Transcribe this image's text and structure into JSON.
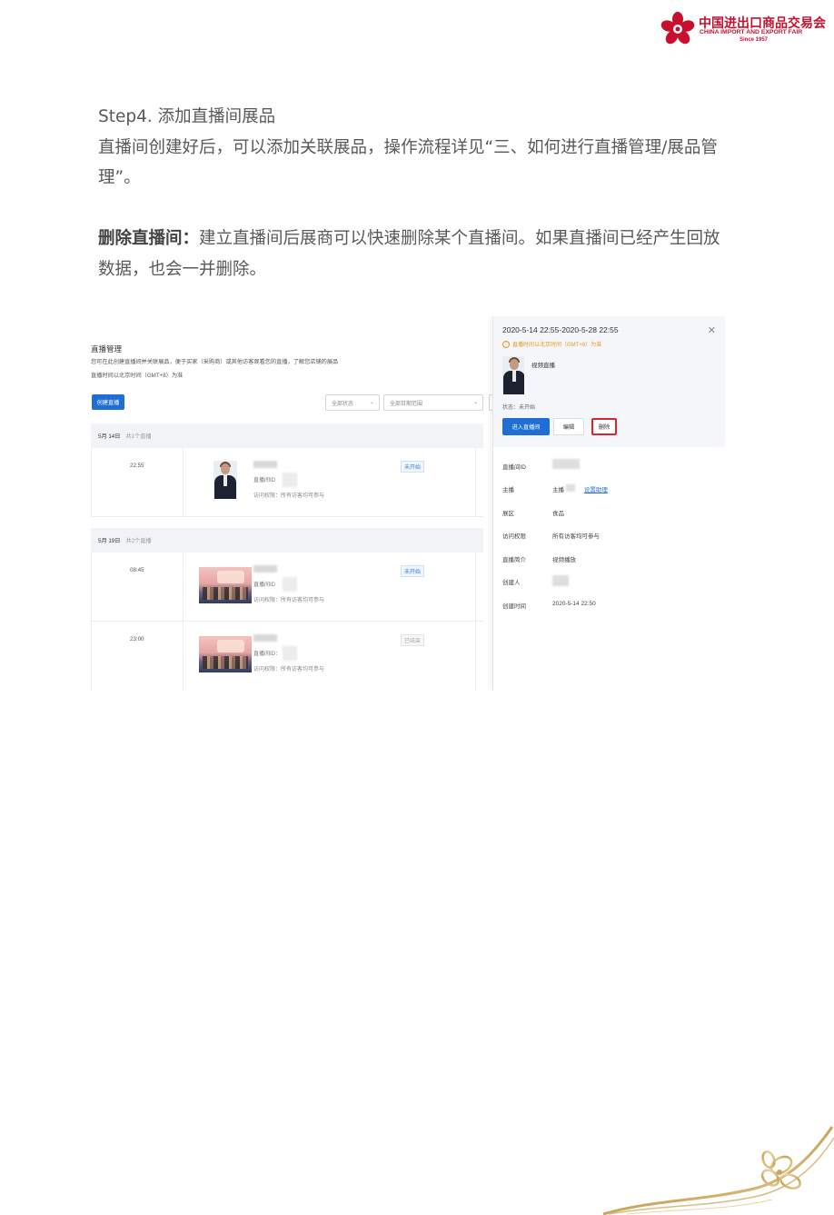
{
  "logo": {
    "cn": "中国进出口商品交易会",
    "en": "CHINA IMPORT AND EXPORT FAIR",
    "since": "Since 1957",
    "brand_color": "#c8102e"
  },
  "step4": {
    "heading": "Step4. 添加直播间展品",
    "body": "直播间创建好后，可以添加关联展品，操作流程详见“三、如何进行直播管理/展品管理”。"
  },
  "delete_section": {
    "label": "删除直播间：",
    "body": "建立直播间后展商可以快速删除某个直播间。如果直播间已经产生回放数据，也会一并删除。"
  },
  "screenshot": {
    "title": "直播管理",
    "desc": "您可在此创建直播间并关联展品，便于买家（采购商）或其他访客观看您的直播，了解您店铺的展品",
    "time_note": "直播时间以北京时间（GMT+8）为准",
    "create_button": "创建直播",
    "filter_status": "全部状态",
    "filter_date": "全部日期范围",
    "days": [
      {
        "date": "5月 14日",
        "count": "共1个直播",
        "rows": [
          {
            "time": "22:55",
            "id_label": "直播间ID",
            "permission": "访问权限：所有访客均可参与",
            "status": "未开始",
            "thumb": "person"
          }
        ]
      },
      {
        "date": "5月 19日",
        "count": "共2个直播",
        "rows": [
          {
            "time": "08:45",
            "id_label": "直播间ID",
            "permission": "访问权限：所有访客均可参与",
            "status": "未开始",
            "thumb": "banner"
          },
          {
            "time": "23:00",
            "id_label": "直播间ID：",
            "permission": "访问权限：所有访客均可参与",
            "status": "已结束",
            "thumb": "banner"
          }
        ]
      }
    ],
    "panel": {
      "range": "2020-5-14 22:55-2020-5-28 22:55",
      "warning": "直播时间以北京时间（GMT+8）为准",
      "name": "视频直播",
      "status": "状态：未开始",
      "enter_button": "进入直播间",
      "edit_button": "编辑",
      "delete_button": "删除",
      "info": [
        {
          "label": "直播间ID",
          "value": ""
        },
        {
          "label": "主播",
          "value": "主播",
          "link": "设置助理"
        },
        {
          "label": "展区",
          "value": "食品"
        },
        {
          "label": "访问权限",
          "value": "所有访客均可参与"
        },
        {
          "label": "直播简介",
          "value": "视频播放"
        },
        {
          "label": "创建人",
          "value": ""
        },
        {
          "label": "创建时间",
          "value": "2020-5-14 22:50"
        }
      ]
    }
  }
}
